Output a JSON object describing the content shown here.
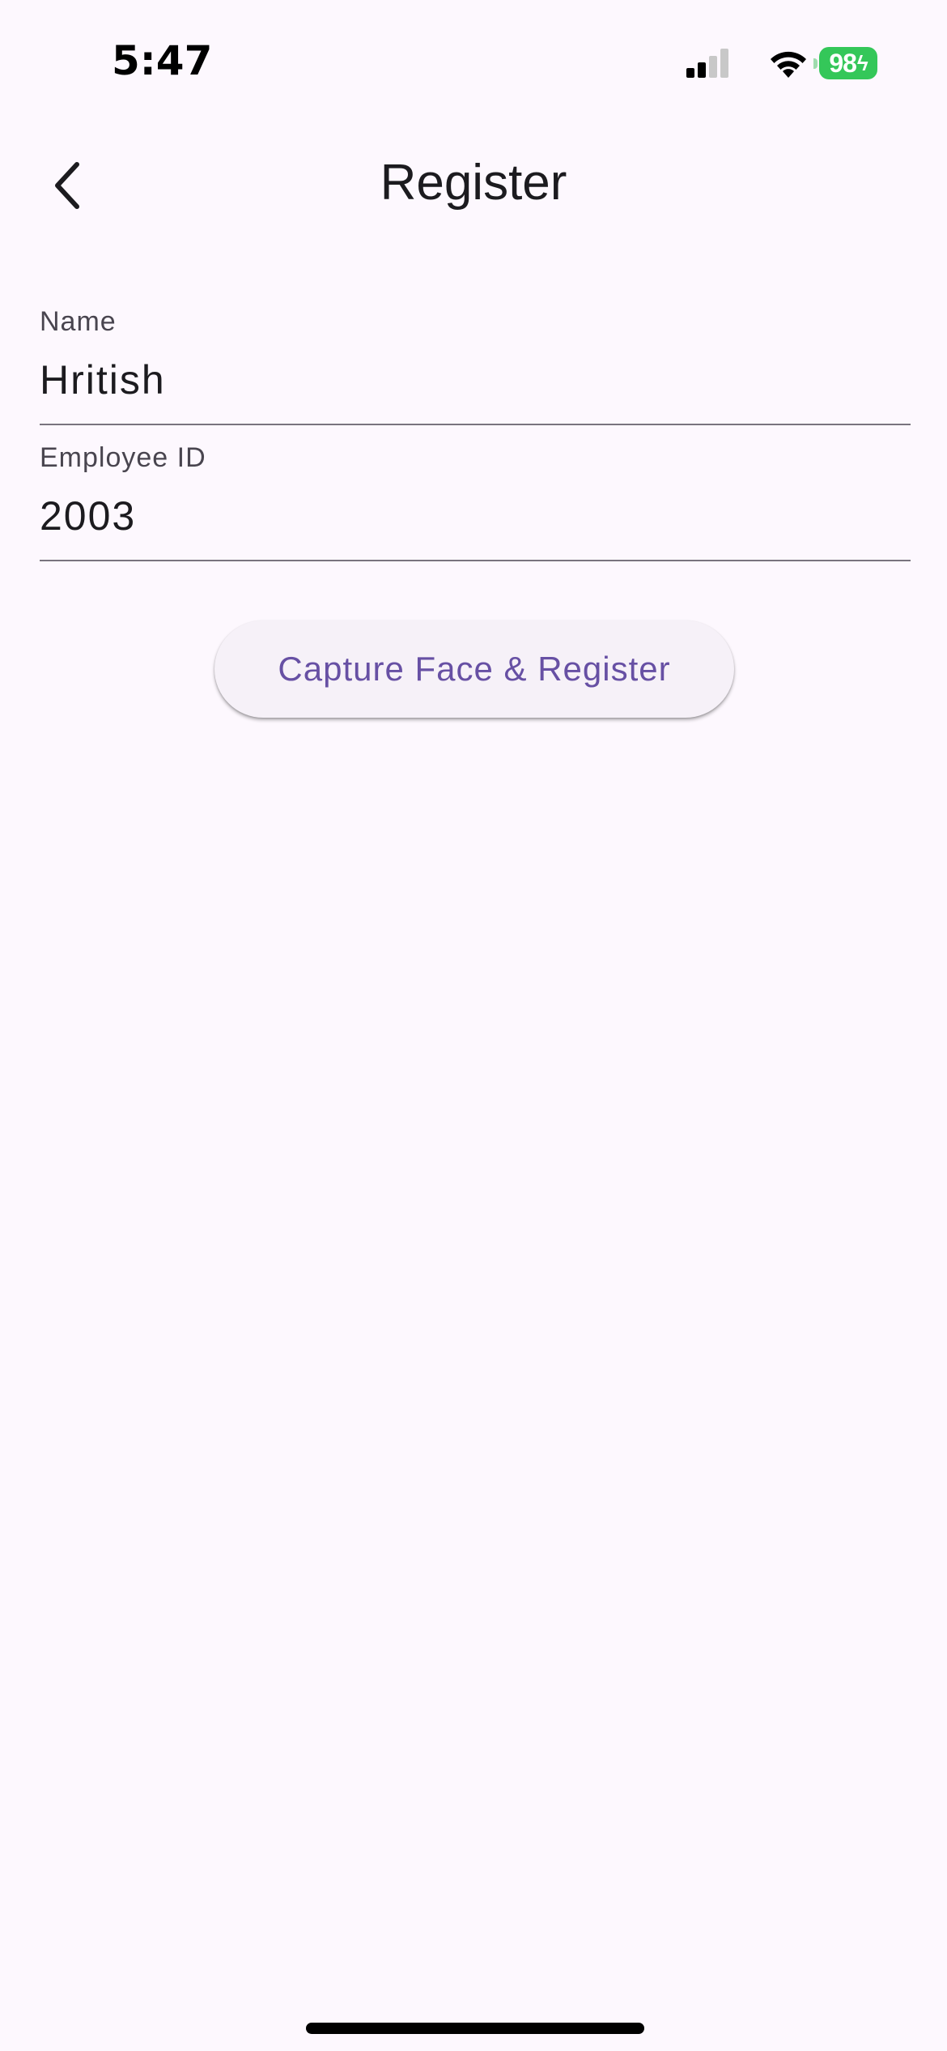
{
  "status_bar": {
    "time": "5:47",
    "battery_level": "98",
    "battery_charging": true,
    "icons": [
      "signal-icon",
      "wifi-icon",
      "battery-icon"
    ]
  },
  "app_bar": {
    "title": "Register",
    "back_icon": "chevron-left-icon"
  },
  "form": {
    "name": {
      "label": "Name",
      "value": "Hritish"
    },
    "employee_id": {
      "label": "Employee ID",
      "value": "2003"
    },
    "submit_label": "Capture Face & Register"
  },
  "colors": {
    "background": "#fdf8fe",
    "accent": "#6750a4",
    "battery": "#34c759"
  }
}
